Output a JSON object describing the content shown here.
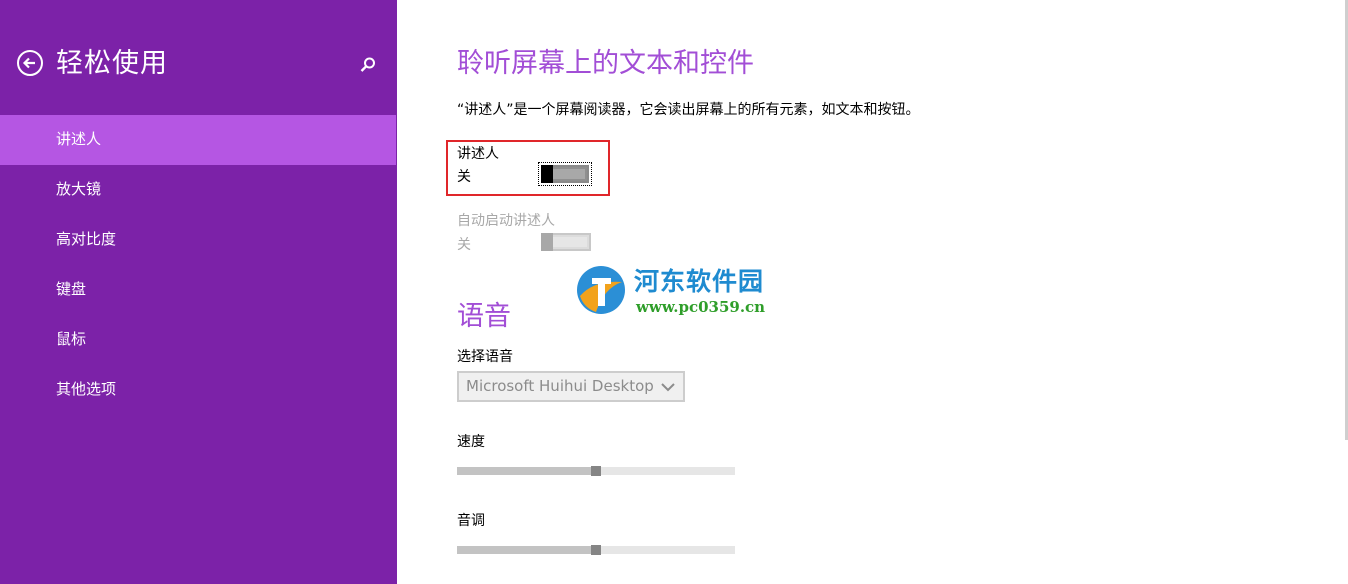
{
  "sidebar": {
    "title": "轻松使用",
    "items": [
      {
        "label": "讲述人",
        "selected": true
      },
      {
        "label": "放大镜"
      },
      {
        "label": "高对比度"
      },
      {
        "label": "键盘"
      },
      {
        "label": "鼠标"
      },
      {
        "label": "其他选项"
      }
    ]
  },
  "main": {
    "heading": "聆听屏幕上的文本和控件",
    "description": "“讲述人”是一个屏幕阅读器，它会读出屏幕上的所有元素，如文本和按钮。",
    "narrator": {
      "label": "讲述人",
      "state": "关",
      "on": false
    },
    "auto_start": {
      "label": "自动启动讲述人",
      "state": "关",
      "on": false,
      "disabled": true
    },
    "voice_heading": "语音",
    "voice_select": {
      "label": "选择语音",
      "value": "Microsoft Huihui Desktop"
    },
    "speed": {
      "label": "速度",
      "value": 0.5
    },
    "pitch": {
      "label": "音调",
      "value": 0.5
    }
  },
  "watermark": {
    "name": "河东软件园",
    "url": "www.pc0359.cn"
  },
  "colors": {
    "sidebar_bg": "#7c22a8",
    "selected_bg": "#b556e3",
    "heading": "#a24ed6",
    "highlight": "#e0262a"
  }
}
